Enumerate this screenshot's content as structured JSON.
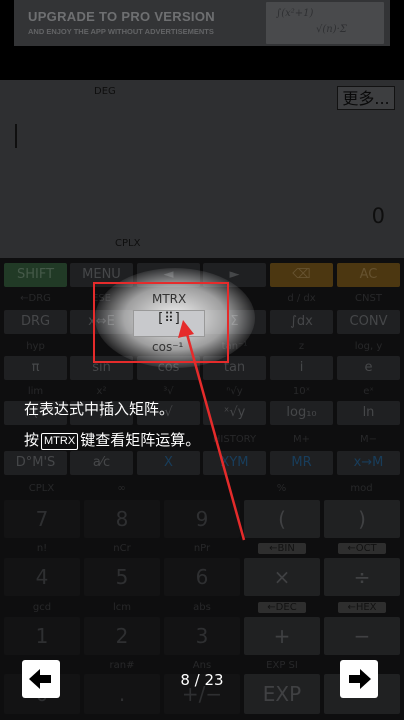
{
  "banner": {
    "title": "UPGRADE TO PRO VERSION",
    "subtitle": "AND ENJOY THE APP WITHOUT ADVERTISEMENTS"
  },
  "display": {
    "mode": "DEG",
    "more_button": "更多...",
    "result": "0",
    "number_mode": "CPLX"
  },
  "keys": {
    "row1": [
      "SHIFT",
      "MENU",
      "◄",
      "►",
      "⌫",
      "AC"
    ],
    "row2_labels": [
      "←DRG",
      "ESE",
      "MTRX",
      "",
      "d / dx",
      "CNST"
    ],
    "row2": [
      "DRG",
      "x⇔E",
      "[⠿]",
      "Σ",
      "∫dx",
      "CONV"
    ],
    "row3_labels": [
      "hyp",
      "",
      "cos⁻¹",
      "tan⁻¹",
      "z",
      "log, y"
    ],
    "row3": [
      "π",
      "sin",
      "cos",
      "tan",
      "i",
      "e"
    ],
    "row4_labels": [
      "lim",
      "x²",
      "³√",
      "ⁿ√y",
      "10ˣ",
      "eˣ"
    ],
    "row4": [
      "(",
      ")",
      "√",
      "ˣ√y",
      "log₁₀",
      "ln"
    ],
    "row5_labels": [
      "",
      "",
      "",
      "HISTORY",
      "M+",
      "M−"
    ],
    "row5": [
      "D°M'S",
      "a⁄c",
      "X",
      "XYM",
      "MR",
      "x→M"
    ],
    "row6_labels": [
      "CPLX",
      "∞",
      "",
      "%",
      "mod"
    ],
    "num_row1": [
      "7",
      "8",
      "9",
      "(",
      ")"
    ],
    "num_row1_labels": [
      "n!",
      "nCr",
      "nPr",
      "←BIN",
      "←OCT"
    ],
    "num_row2": [
      "4",
      "5",
      "6",
      "×",
      "÷"
    ],
    "num_row2_labels": [
      "gcd",
      "lcm",
      "abs",
      "←DEC",
      "←HEX"
    ],
    "num_row3": [
      "1",
      "2",
      "3",
      "+",
      "−"
    ],
    "num_row3_labels": [
      "",
      "ran#",
      "Ans",
      "EXP SI",
      ""
    ],
    "num_row4": [
      "0",
      ".",
      "+/−",
      "EXP",
      "="
    ]
  },
  "tutorial": {
    "highlight_top": "MTRX",
    "highlight_key": "[⠿]",
    "highlight_bottom": "cos⁻¹",
    "line1": "在表达式中插入矩阵。",
    "line2_prefix": "按",
    "line2_key": "MTRX",
    "line2_suffix": "键查看矩阵运算。",
    "page_counter": "8 / 23"
  },
  "colors": {
    "highlight_box": "#e52b2b",
    "shift_key": "#3c6b45",
    "ac_key": "#8a6420",
    "blue_text": "#2c6fa6"
  }
}
